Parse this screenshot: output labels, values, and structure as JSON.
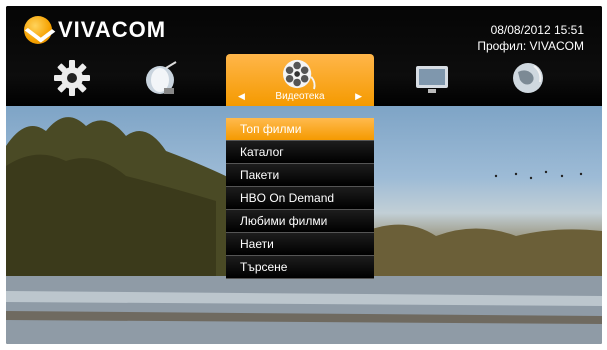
{
  "brand": {
    "name": "VIVACOM"
  },
  "status": {
    "datetime": "08/08/2012   15:51",
    "profile": "Профил: VIVACOM"
  },
  "top_menu": {
    "icons": [
      "gear-icon",
      "satellite-dish-icon",
      "film-reel-icon",
      "tv-icon",
      "globe-icon"
    ],
    "selected_label": "Видеотека"
  },
  "submenu": {
    "items": [
      "Топ филми",
      "Каталог",
      "Пакети",
      "HBO On Demand",
      "Любими филми",
      "Наети",
      "Търсене"
    ],
    "active_index": 0
  },
  "colors": {
    "accent": "#f59a00"
  }
}
